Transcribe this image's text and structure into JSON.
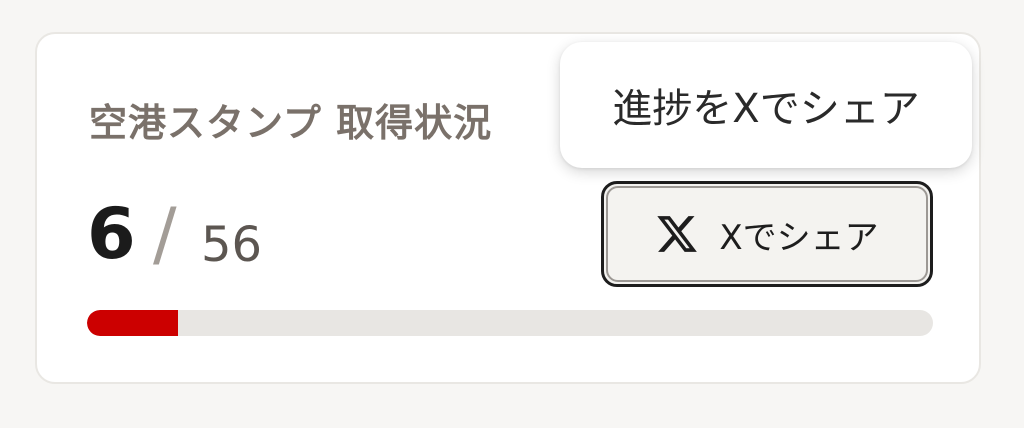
{
  "card": {
    "title": "空港スタンプ 取得状況",
    "collected": "6",
    "separator": "/",
    "total": "56",
    "progress_fraction": 0.107
  },
  "share": {
    "button_label": "Xでシェア",
    "button_icon": "x-logo-icon",
    "tooltip": "進捗をXでシェア"
  },
  "colors": {
    "progress_fill": "#cc0000",
    "progress_track": "#e8e6e3",
    "title": "#7a716a"
  }
}
